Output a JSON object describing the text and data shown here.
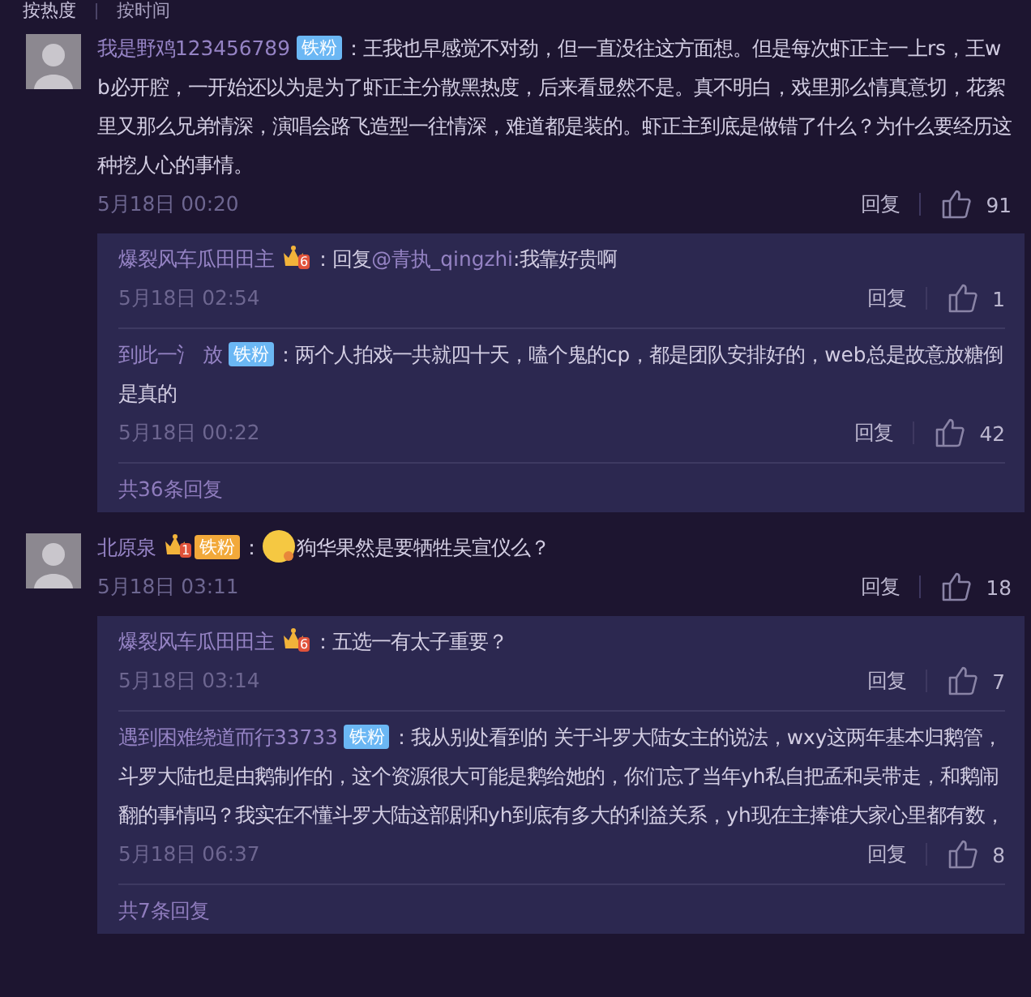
{
  "sort_tabs": [
    {
      "label": "按热度",
      "selected": true
    },
    {
      "label": "按时间",
      "selected": false
    }
  ],
  "comments": [
    {
      "name": "我是野鸡123456789",
      "badges": [
        {
          "kind": "fan",
          "text": "铁粉"
        }
      ],
      "content": [
        {
          "kind": "text",
          "text": "：王我也早感觉不对劲，但一直没往这方面想。但是每次虾正主一上rs，王wb必开腔，一开始还以为是为了虾正主分散黑热度，后来看显然不是。真不明白，戏里那么情真意切，花絮里又那么兄弟情深，演唱会路飞造型一往情深，难道都是装的。虾正主到底是做错了什么？为什么要经历这种挖人心的事情。"
        }
      ],
      "time": "5月18日 00:20",
      "reply_label": "回复",
      "likes": "91",
      "replies": [
        {
          "name": "爆裂风车瓜田田主",
          "badges": [
            {
              "kind": "crown",
              "level": "6"
            }
          ],
          "content": [
            {
              "kind": "text",
              "text": "：回复"
            },
            {
              "kind": "mention",
              "text": "@青执_qingzhi"
            },
            {
              "kind": "text",
              "text": ":我靠好贵啊"
            }
          ],
          "time": "5月18日 02:54",
          "reply_label": "回复",
          "likes": "1"
        },
        {
          "name": "到此一氵 放",
          "badges": [
            {
              "kind": "fan",
              "text": "铁粉"
            }
          ],
          "content": [
            {
              "kind": "text",
              "text": "：两个人拍戏一共就四十天，嗑个鬼的cp，都是团队安排好的，web总是故意放糖倒是真的"
            }
          ],
          "time": "5月18日 00:22",
          "reply_label": "回复",
          "likes": "42"
        }
      ],
      "replies_total": "共36条回复"
    },
    {
      "name": "北原泉",
      "badges": [
        {
          "kind": "crown",
          "level": "1"
        },
        {
          "kind": "fan_gold",
          "text": "铁粉"
        }
      ],
      "content": [
        {
          "kind": "text",
          "text": "："
        },
        {
          "kind": "emoji"
        },
        {
          "kind": "text",
          "text": "狗华果然是要牺牲吴宣仪么？"
        }
      ],
      "time": "5月18日 03:11",
      "reply_label": "回复",
      "likes": "18",
      "replies": [
        {
          "name": "爆裂风车瓜田田主",
          "badges": [
            {
              "kind": "crown",
              "level": "6"
            }
          ],
          "content": [
            {
              "kind": "text",
              "text": "：五选一有太子重要？"
            }
          ],
          "time": "5月18日 03:14",
          "reply_label": "回复",
          "likes": "7"
        },
        {
          "name": "遇到困难绕道而行33733",
          "badges": [
            {
              "kind": "fan",
              "text": "铁粉"
            }
          ],
          "content": [
            {
              "kind": "text",
              "text": "：我从别处看到的 关于斗罗大陆女主的说法，wxy这两年基本归鹅管，斗罗大陆也是由鹅制作的，这个资源很大可能是鹅给她的，你们忘了当年yh私自把孟和吴带走，和鹅闹翻的事情吗？我实在不懂斗罗大陆这部剧和yh到底有多大的利益关系，yh现在主捧谁大家心里都有数，"
            }
          ],
          "time": "5月18日 06:37",
          "reply_label": "回复",
          "likes": "8"
        }
      ],
      "replies_total": "共7条回复"
    }
  ]
}
